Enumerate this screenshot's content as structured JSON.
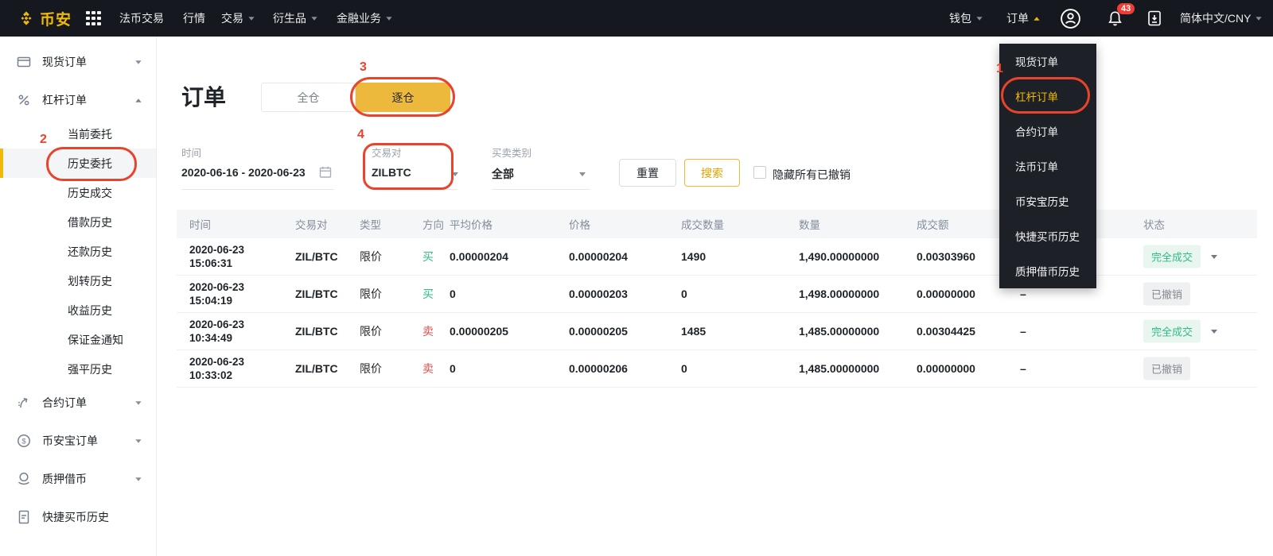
{
  "colors": {
    "accent": "#f0b90b",
    "nav_bg": "#15181e",
    "buy_green": "#2ebd85",
    "sell_red": "#d9534f",
    "annotation_red": "#e8432c",
    "badge_filled_bg": "#e9f6f0",
    "badge_canceled_bg": "#eef0f2"
  },
  "topnav": {
    "brand": "币安",
    "menu": [
      {
        "label": "法币交易",
        "dropdown": false
      },
      {
        "label": "行情",
        "dropdown": false
      },
      {
        "label": "交易",
        "dropdown": true
      },
      {
        "label": "衍生品",
        "dropdown": true
      },
      {
        "label": "金融业务",
        "dropdown": true
      }
    ],
    "wallet": "钱包",
    "orders": "订单",
    "notification_count": "43",
    "language": "简体中文/CNY",
    "icons": [
      "binance-logo",
      "apps-grid-icon",
      "user-icon",
      "bell-icon",
      "app-download-icon"
    ]
  },
  "sidebar": {
    "spot": "现货订单",
    "margin": "杠杆订单",
    "margin_subs": [
      "当前委托",
      "历史委托",
      "历史成交",
      "借款历史",
      "还款历史",
      "划转历史",
      "收益历史",
      "保证金通知",
      "强平历史"
    ],
    "active_sub": "历史委托",
    "futures": "合约订单",
    "savings": "币安宝订单",
    "loan": "质押借币",
    "quickbuy": "快捷买币历史"
  },
  "main": {
    "title": "订单",
    "toggle": {
      "cross": "全仓",
      "isolated": "逐仓",
      "selected": "逐仓"
    },
    "filters": {
      "date_label": "时间",
      "date_value": "2020-06-16 - 2020-06-23",
      "pair_label": "交易对",
      "pair_value": "ZILBTC",
      "side_label": "买卖类别",
      "side_value": "全部",
      "reset": "重置",
      "search": "搜索",
      "hide_canceled": "隐藏所有已撤销"
    }
  },
  "table": {
    "headers": [
      "时间",
      "交易对",
      "类型",
      "方向",
      "平均价格",
      "价格",
      "成交数量",
      "数量",
      "成交额",
      "",
      "状态"
    ],
    "rows": [
      {
        "date": "2020-06-23",
        "time": "15:06:31",
        "pair": "ZIL/BTC",
        "type": "限价",
        "side": "买",
        "side_dir": "buy",
        "avg_price": "0.00000204",
        "price": "0.00000204",
        "filled_qty": "1490",
        "qty": "1,490.00000000",
        "total": "0.00303960",
        "trigger": "",
        "status": "完全成交",
        "status_type": "filled",
        "expandable": true
      },
      {
        "date": "2020-06-23",
        "time": "15:04:19",
        "pair": "ZIL/BTC",
        "type": "限价",
        "side": "买",
        "side_dir": "buy",
        "avg_price": "0",
        "price": "0.00000203",
        "filled_qty": "0",
        "qty": "1,498.00000000",
        "total": "0.00000000",
        "trigger": "–",
        "status": "已撤销",
        "status_type": "canceled",
        "expandable": false
      },
      {
        "date": "2020-06-23",
        "time": "10:34:49",
        "pair": "ZIL/BTC",
        "type": "限价",
        "side": "卖",
        "side_dir": "sell",
        "avg_price": "0.00000205",
        "price": "0.00000205",
        "filled_qty": "1485",
        "qty": "1,485.00000000",
        "total": "0.00304425",
        "trigger": "–",
        "status": "完全成交",
        "status_type": "filled",
        "expandable": true
      },
      {
        "date": "2020-06-23",
        "time": "10:33:02",
        "pair": "ZIL/BTC",
        "type": "限价",
        "side": "卖",
        "side_dir": "sell",
        "avg_price": "0",
        "price": "0.00000206",
        "filled_qty": "0",
        "qty": "1,485.00000000",
        "total": "0.00000000",
        "trigger": "–",
        "status": "已撤销",
        "status_type": "canceled",
        "expandable": false
      }
    ]
  },
  "orders_menu": {
    "items": [
      {
        "label": "现货订单",
        "active": false
      },
      {
        "label": "杠杆订单",
        "active": true
      },
      {
        "label": "合约订单",
        "active": false
      },
      {
        "label": "法币订单",
        "active": false
      },
      {
        "label": "币安宝历史",
        "active": false
      },
      {
        "label": "快捷买币历史",
        "active": false
      },
      {
        "label": "质押借币历史",
        "active": false
      }
    ]
  },
  "annotations": {
    "steps": [
      "1",
      "2",
      "3",
      "4"
    ]
  }
}
